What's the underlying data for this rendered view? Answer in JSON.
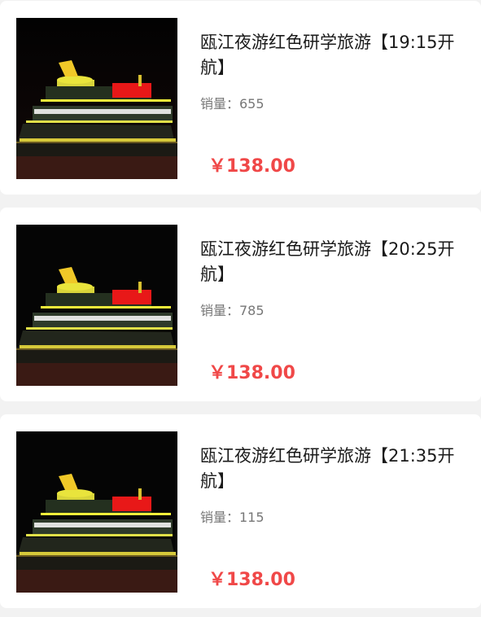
{
  "colors": {
    "background": "#f2f2f2",
    "card": "#ffffff",
    "title": "#1a1a1a",
    "sales": "#777777",
    "price": "#f04848"
  },
  "products": [
    {
      "image_icon": "night-cruise-ship-image",
      "title": "瓯江夜游红色研学旅游【19:15开航】",
      "sales_label": "销量：655",
      "price": "￥138.00"
    },
    {
      "image_icon": "night-cruise-ship-image",
      "title": "瓯江夜游红色研学旅游【20:25开航】",
      "sales_label": "销量：785",
      "price": "￥138.00"
    },
    {
      "image_icon": "night-cruise-ship-image",
      "title": "瓯江夜游红色研学旅游【21:35开航】",
      "sales_label": "销量：115",
      "price": "￥138.00"
    }
  ]
}
